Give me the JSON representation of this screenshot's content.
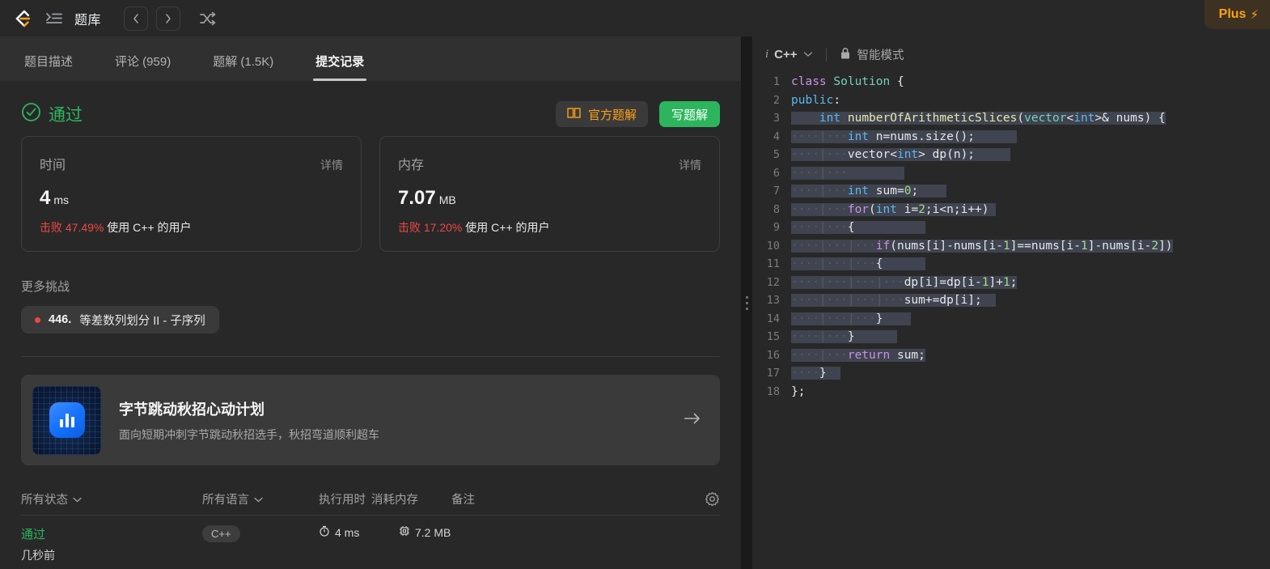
{
  "topnav": {
    "logo_icon": "leetcode-logo-icon",
    "menu_icon": "list-menu-icon",
    "title": "题库",
    "prev_icon": "chevron-left-icon",
    "next_icon": "chevron-right-icon",
    "shuffle_icon": "shuffle-icon",
    "plus_label": "Plus",
    "plus_icon": "lightning-icon"
  },
  "tabs": [
    {
      "label": "题目描述",
      "active": false
    },
    {
      "label": "评论 (959)",
      "active": false
    },
    {
      "label": "题解 (1.5K)",
      "active": false
    },
    {
      "label": "提交记录",
      "active": true
    }
  ],
  "result": {
    "status_icon": "check-circle-icon",
    "status_text": "通过",
    "official_solution_label": "官方题解",
    "official_solution_icon": "book-icon",
    "write_solution_label": "写题解"
  },
  "stats": [
    {
      "label": "时间",
      "detail_label": "详情",
      "value": "4",
      "unit": "ms",
      "beat_prefix": "击败",
      "beat_percent": "47.49%",
      "beat_suffix": "使用 C++ 的用户"
    },
    {
      "label": "内存",
      "detail_label": "详情",
      "value": "7.07",
      "unit": "MB",
      "beat_prefix": "击败",
      "beat_percent": "17.20%",
      "beat_suffix": "使用 C++ 的用户"
    }
  ],
  "more_challenges": {
    "title": "更多挑战",
    "chip_number": "446.",
    "chip_title": "等差数列划分 II - 子序列"
  },
  "promo": {
    "icon_name": "bytedance-chart-icon",
    "title": "字节跳动秋招心动计划",
    "subtitle": "面向短期冲刺字节跳动秋招选手，秋招弯道顺利超车",
    "arrow_icon": "arrow-right-icon"
  },
  "submissions_table": {
    "columns": [
      {
        "label": "所有状态",
        "has_caret": true
      },
      {
        "label": "所有语言",
        "has_caret": true
      },
      {
        "label": "执行用时",
        "has_caret": false
      },
      {
        "label": "消耗内存",
        "has_caret": false
      },
      {
        "label": "备注",
        "has_caret": false
      }
    ],
    "settings_icon": "gear-icon",
    "rows": [
      {
        "status": "通过",
        "when": "几秒前",
        "language": "C++",
        "runtime": "4 ms",
        "runtime_icon": "clock-icon",
        "memory": "7.2 MB",
        "memory_icon": "chip-icon",
        "note": ""
      }
    ]
  },
  "splitter": {
    "handle_icon": "drag-handle-icon"
  },
  "editor": {
    "info_icon": "info-icon",
    "language": "C++",
    "caret_icon": "chevron-down-icon",
    "lock_icon": "lock-icon",
    "smart_mode_label": "智能模式",
    "line_numbers": [
      1,
      2,
      3,
      4,
      5,
      6,
      7,
      8,
      9,
      10,
      11,
      12,
      13,
      14,
      15,
      16,
      17,
      18
    ],
    "code_lines": [
      "class Solution {",
      "public:",
      "    int numberOfArithmeticSlices(vector<int>& nums) {",
      "        int n=nums.size();",
      "        vector<int> dp(n);",
      "",
      "        int sum=0;",
      "        for(int i=2;i<n;i++)",
      "        {",
      "            if(nums[i]-nums[i-1]==nums[i-1]-nums[i-2])",
      "            {",
      "                dp[i]=dp[i-1]+1;",
      "                sum+=dp[i];",
      "            }",
      "        }",
      "        return sum;",
      "    }",
      "};"
    ]
  },
  "colors": {
    "accent_orange": "#ffa116",
    "success_green": "#2db55d",
    "danger_red": "#ef4743",
    "panel_bg": "#282828",
    "app_bg": "#1a1a1a"
  }
}
